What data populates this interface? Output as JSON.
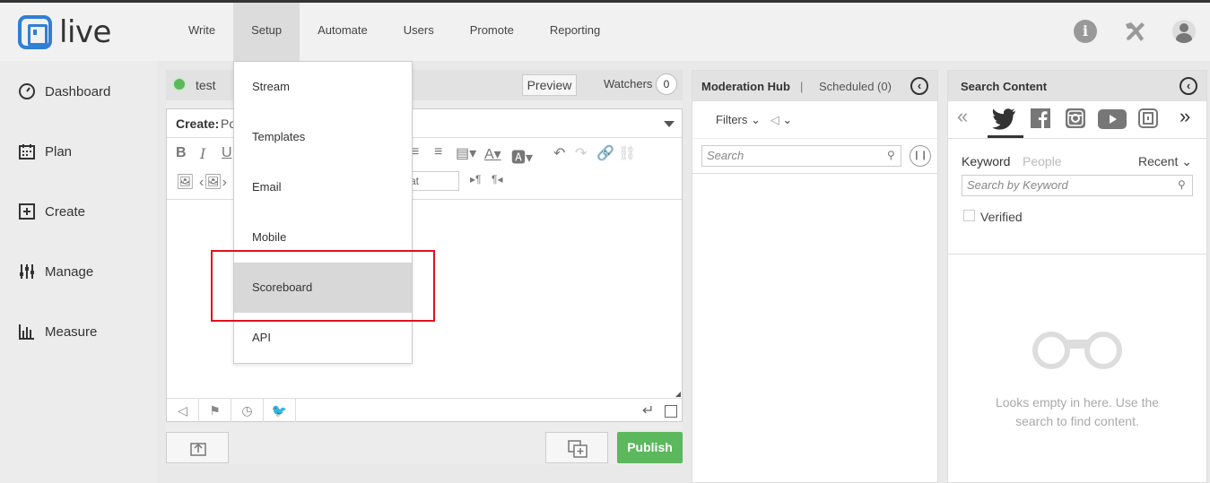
{
  "logo": {
    "text": "live",
    "color": "#2f7fd4"
  },
  "nav": [
    {
      "label": "Write"
    },
    {
      "label": "Setup",
      "active": true
    },
    {
      "label": "Automate"
    },
    {
      "label": "Users"
    },
    {
      "label": "Promote"
    },
    {
      "label": "Reporting"
    }
  ],
  "top_icons": [
    "info-icon",
    "tools-icon",
    "user-avatar-icon"
  ],
  "sidebar": {
    "items": [
      {
        "label": "Dashboard",
        "icon": "dashboard-icon"
      },
      {
        "label": "Plan",
        "icon": "calendar-icon"
      },
      {
        "label": "Create",
        "icon": "plus-square-icon"
      },
      {
        "label": "Manage",
        "icon": "sliders-icon"
      },
      {
        "label": "Measure",
        "icon": "bar-chart-icon"
      }
    ]
  },
  "compose": {
    "title": "test",
    "status_color": "#5cb85c",
    "preview_label": "Preview",
    "watchers_label": "Watchers",
    "watchers_count": "0",
    "create_label": "Create:",
    "create_type": "Po",
    "format_select": "at",
    "publish_label": "Publish",
    "publish_color": "#5cb85c"
  },
  "setup_menu": {
    "items": [
      {
        "label": "Stream"
      },
      {
        "label": "Templates"
      },
      {
        "label": "Email"
      },
      {
        "label": "Mobile"
      },
      {
        "label": "Scoreboard",
        "highlighted": true
      },
      {
        "label": "API"
      }
    ],
    "highlight_color": "#e0121a"
  },
  "moderation": {
    "title": "Moderation Hub",
    "separator": "|",
    "scheduled": "Scheduled (0)",
    "filters_label": "Filters",
    "search_placeholder": "Search"
  },
  "search_content": {
    "title": "Search Content",
    "tabs_keyword": "Keyword",
    "tabs_people": "People",
    "sort": "Recent",
    "search_placeholder": "Search by Keyword",
    "verified_label": "Verified",
    "empty_text": "Looks empty in here. Use the search to find content.",
    "networks": [
      "twitter-icon",
      "facebook-icon",
      "instagram-icon",
      "youtube-icon",
      "live-icon"
    ]
  }
}
